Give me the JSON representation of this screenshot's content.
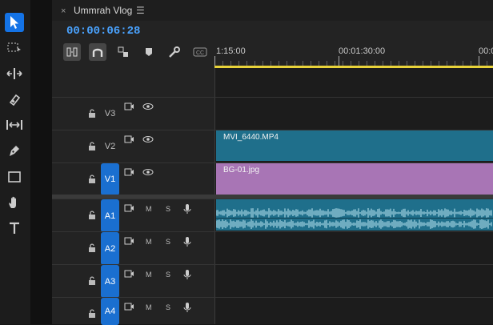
{
  "sequence": {
    "tab_title": "Ummrah Vlog",
    "close_glyph": "×",
    "menu_glyph": "☰",
    "timecode": "00:00:06:28"
  },
  "ruler": {
    "labels": [
      "1:15:00",
      "00:01:30:00",
      "00:0"
    ]
  },
  "tracks": {
    "video": [
      {
        "name": "V3",
        "targeted": false
      },
      {
        "name": "V2",
        "targeted": false
      },
      {
        "name": "V1",
        "targeted": true
      }
    ],
    "audio": [
      {
        "name": "A1",
        "targeted": true,
        "mute": "M",
        "solo": "S"
      },
      {
        "name": "A2",
        "targeted": true,
        "mute": "M",
        "solo": "S"
      },
      {
        "name": "A3",
        "targeted": true,
        "mute": "M",
        "solo": "S"
      },
      {
        "name": "A4",
        "targeted": true,
        "mute": "M",
        "solo": "S"
      }
    ]
  },
  "clips": {
    "v2": {
      "name": "MVI_6440.MP4",
      "color": "#1f6f8b"
    },
    "v1": {
      "name": "BG-01.jpg",
      "color": "#a875b5"
    },
    "a1": {
      "color": "#1f6f8b"
    }
  },
  "tool_icons": [
    "selection-tool-icon",
    "track-select-tool-icon",
    "ripple-edit-tool-icon",
    "razor-tool-icon",
    "slip-tool-icon",
    "pen-tool-icon",
    "rectangle-tool-icon",
    "hand-tool-icon",
    "type-tool-icon"
  ],
  "colors": {
    "accent": "#1473e6",
    "timecode": "#4aa3ff",
    "work_area": "#e8d33a"
  }
}
